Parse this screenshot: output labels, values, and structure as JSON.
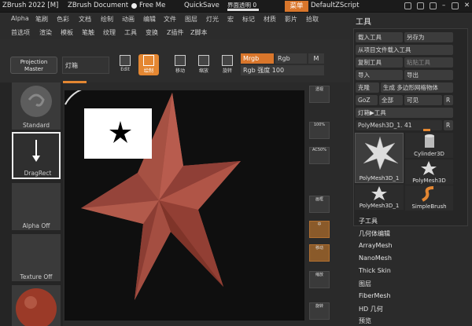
{
  "titlebar": {
    "app_title": "ZBrush 2022 [M]",
    "document": "ZBrush Document",
    "free_mem": "Free Me",
    "quicksave": "QuickSave",
    "transparency": "界面透明 0",
    "menu_label": "菜单",
    "script": "DefaultZScript"
  },
  "menubar": {
    "row1": [
      "Alpha",
      "笔刷",
      "色彩",
      "文档",
      "绘制",
      "动画",
      "编辑",
      "文件",
      "图层",
      "灯光",
      "宏",
      "标记",
      "材质",
      "影片",
      "拾取"
    ],
    "row2": [
      "首选项",
      "渲染",
      "模板",
      "笔触",
      "纹理",
      "工具",
      "变换",
      "Z插件",
      "Z脚本"
    ]
  },
  "toolbar": {
    "projection_master": "Projection Master",
    "lightbox": "灯箱",
    "edit": "Edit",
    "draw": "绘制",
    "move": "移动",
    "scale": "缩放",
    "rotate": "旋转",
    "mrgb": "Mrgb",
    "rgb": "Rgb",
    "m": "M",
    "rgb_intensity": "Rgb 强度 100"
  },
  "leftshelf": {
    "standard": "Standard",
    "dragrect": "DragRect",
    "alpha_off": "Alpha Off",
    "texture_off": "Texture Off"
  },
  "rightshelf": {
    "items": [
      "透视",
      "100%",
      "AC50%",
      "画框",
      "中",
      "移动",
      "缩放",
      "旋转"
    ]
  },
  "toolpanel": {
    "title": "工具",
    "load_tool": "载入工具",
    "save_as": "另存为",
    "load_from_project": "从项目文件载入工具",
    "copy_tool": "复制工具",
    "paste_tool": "粘贴工具",
    "import": "导入",
    "export": "导出",
    "clone": "克隆",
    "make_polymesh": "生成 多边形网格物体",
    "goz": "GoZ",
    "all": "全部",
    "visible": "可见",
    "r": "R",
    "lightbox_tools": "灯箱▶工具",
    "current_tool": "PolyMesh3D_1. 41",
    "thumbs": [
      "PolyMesh3D_1",
      "Cylinder3D",
      "PolyMesh3D_1",
      "PolyMesh3D",
      "SimpleBrush"
    ],
    "subpalettes": [
      "子工具",
      "几何体编辑",
      "ArrayMesh",
      "NanoMesh",
      "Thick Skin",
      "图层",
      "FiberMesh",
      "HD 几何",
      "预览"
    ]
  },
  "colors": {
    "accent": "#e48732",
    "star": "#a34d42"
  }
}
